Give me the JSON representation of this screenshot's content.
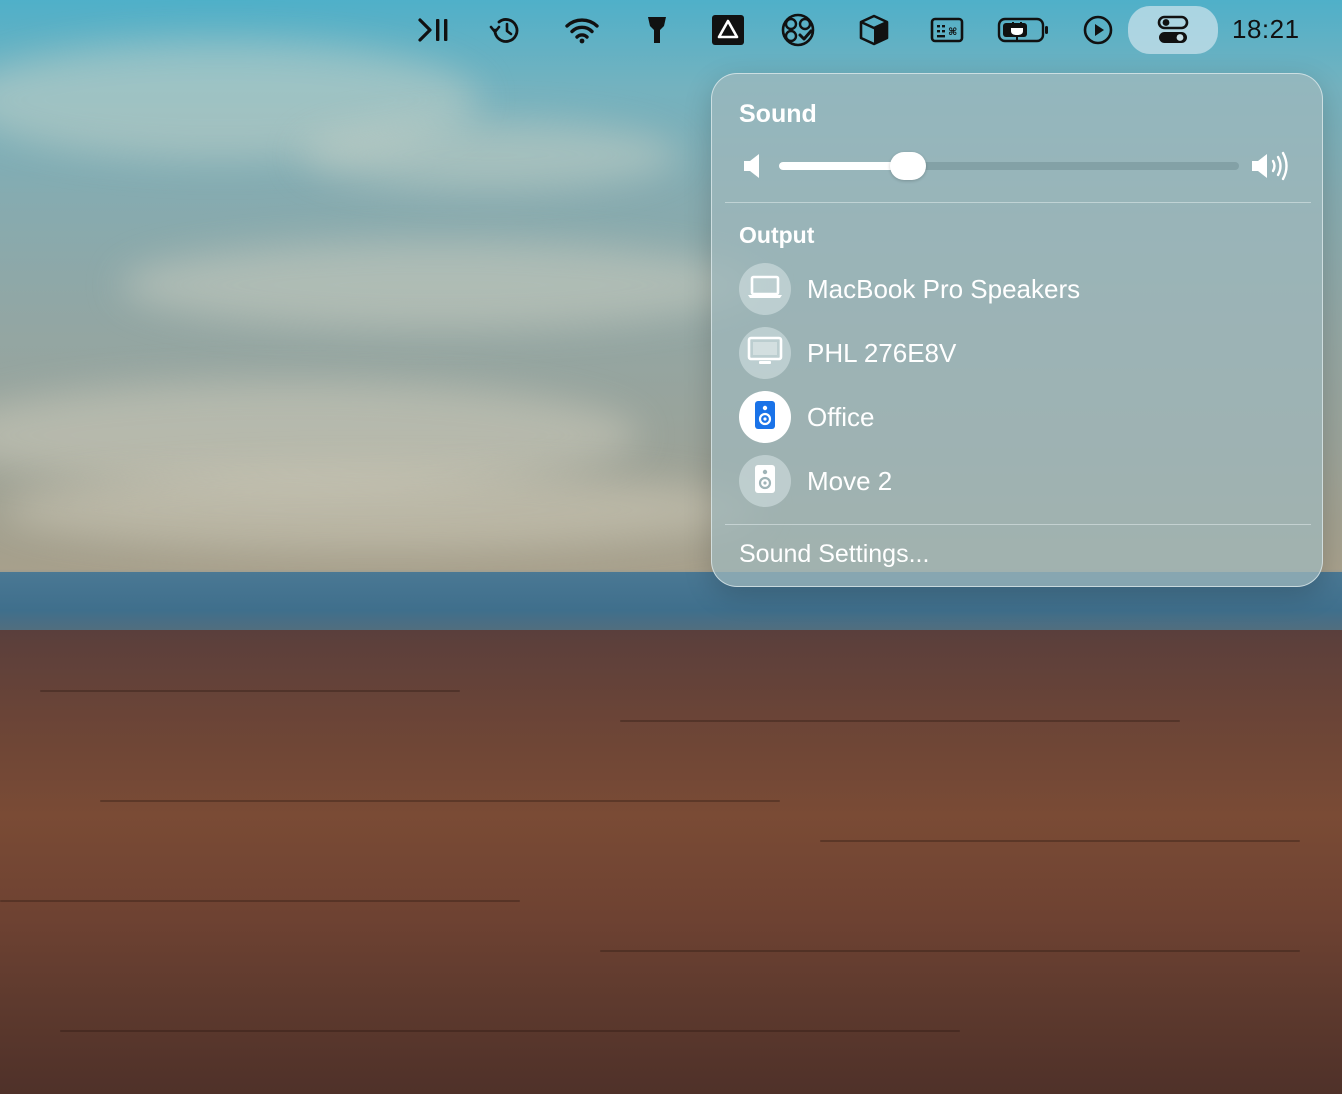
{
  "menubar": {
    "icons": [
      "play-pause-icon",
      "time-machine-icon",
      "wifi-icon",
      "flashlight-icon",
      "drive-icon",
      "app-badge-icon",
      "package-icon",
      "keyboard-viewer-icon",
      "battery-icon",
      "play-circle-icon",
      "control-center-icon"
    ],
    "clock": "18:21"
  },
  "sound_panel": {
    "title": "Sound",
    "volume_percent": 28,
    "output_title": "Output",
    "devices": [
      {
        "label": "MacBook Pro Speakers",
        "icon": "laptop-icon",
        "selected": false
      },
      {
        "label": "PHL 276E8V",
        "icon": "monitor-icon",
        "selected": false
      },
      {
        "label": "Office",
        "icon": "speaker-icon",
        "selected": true
      },
      {
        "label": "Move 2",
        "icon": "speaker-icon",
        "selected": false
      }
    ],
    "settings_label": "Sound Settings..."
  },
  "colors": {
    "accent_blue": "#1a73e8",
    "panel_text": "#ffffff"
  }
}
